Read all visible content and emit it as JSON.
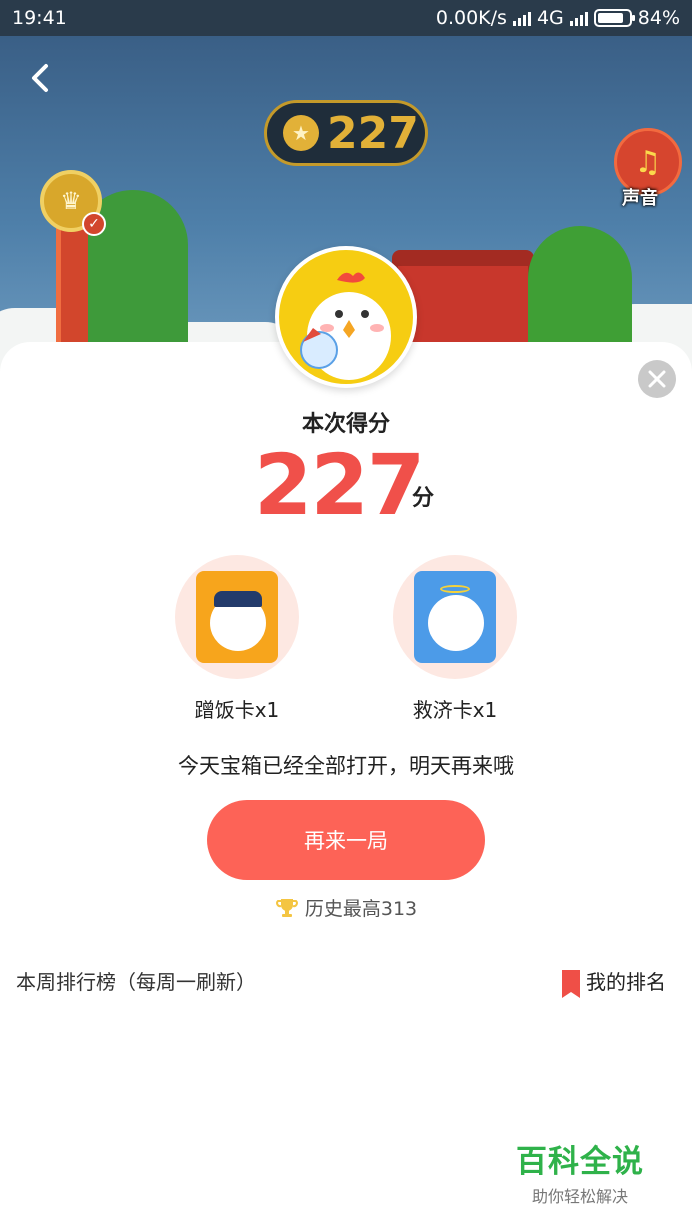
{
  "status_bar": {
    "time": "19:41",
    "network_speed": "0.00K/s",
    "network_type": "4G",
    "battery": "84%"
  },
  "header": {
    "back_icon": "chevron-left-icon",
    "coin_count": "227",
    "sound_label": "声音",
    "sound_icon": "music-note-icon"
  },
  "result": {
    "score_label": "本次得分",
    "score": "227",
    "score_unit": "分"
  },
  "rewards": [
    {
      "label": "蹭饭卡x1",
      "color": "#f7a51c",
      "icon": "police-chick-card-icon"
    },
    {
      "label": "救济卡x1",
      "color": "#4c9be8",
      "icon": "angel-chick-card-icon"
    }
  ],
  "notice": "今天宝箱已经全部打开，明天再来哦",
  "play_again_label": "再来一局",
  "best_score": "历史最高313",
  "leaderboard": {
    "title": "本周排行榜（每周一刷新）",
    "my_rank_label": "我的排名"
  },
  "watermark": {
    "main": "百科全说",
    "sub": "助你轻松解决"
  },
  "colors": {
    "accent": "#fd6357",
    "score": "#f0504a",
    "coin": "#e2b138",
    "watermark": "#2fb24a"
  }
}
